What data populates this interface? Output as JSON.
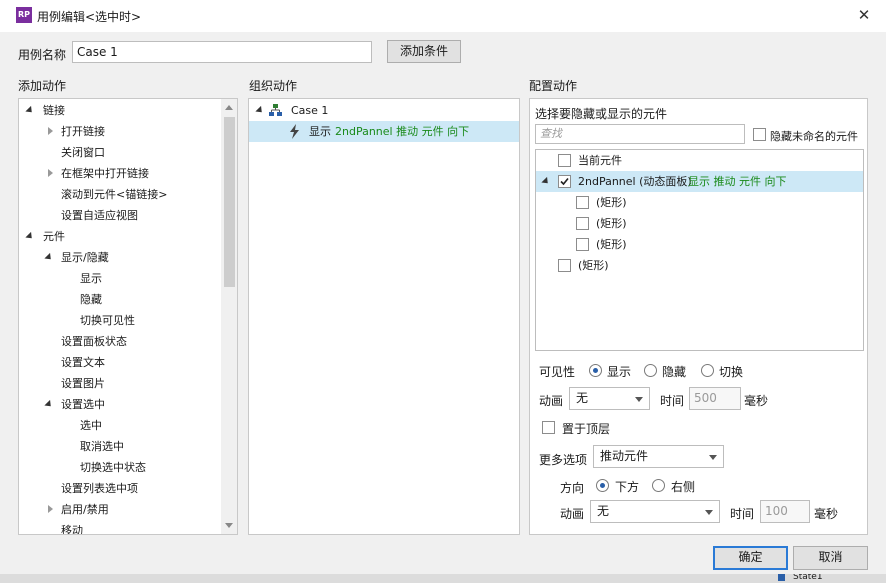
{
  "window": {
    "title": "用例编辑<选中时>",
    "app_icon": "RP"
  },
  "case_name": {
    "label": "用例名称",
    "value": "Case 1",
    "add_condition": "添加条件"
  },
  "add_actions": {
    "heading": "添加动作",
    "items": [
      {
        "label": "链接"
      },
      {
        "label": "打开链接"
      },
      {
        "label": "关闭窗口"
      },
      {
        "label": "在框架中打开链接"
      },
      {
        "label": "滚动到元件<锚链接>"
      },
      {
        "label": "设置自适应视图"
      },
      {
        "label": "元件"
      },
      {
        "label": "显示/隐藏"
      },
      {
        "label": "显示"
      },
      {
        "label": "隐藏"
      },
      {
        "label": "切换可见性"
      },
      {
        "label": "设置面板状态"
      },
      {
        "label": "设置文本"
      },
      {
        "label": "设置图片"
      },
      {
        "label": "设置选中"
      },
      {
        "label": "选中"
      },
      {
        "label": "取消选中"
      },
      {
        "label": "切换选中状态"
      },
      {
        "label": "设置列表选中项"
      },
      {
        "label": "启用/禁用"
      },
      {
        "label": "移动"
      }
    ]
  },
  "organize_actions": {
    "heading": "组织动作",
    "case": "Case 1",
    "action": {
      "verb": "显示",
      "detail": "2ndPannel 推动 元件 向下"
    }
  },
  "configure": {
    "heading": "配置动作",
    "prompt": "选择要隐藏或显示的元件",
    "search_placeholder": "查找",
    "hide_unnamed": "隐藏未命名的元件",
    "widgets": [
      {
        "label": "当前元件",
        "checked": false
      },
      {
        "label": "2ndPannel (动态面板)",
        "status": "显示 推动 元件 向下",
        "checked": true
      },
      {
        "label": "(矩形)",
        "checked": false
      },
      {
        "label": "(矩形)",
        "checked": false
      },
      {
        "label": "(矩形)",
        "checked": false
      },
      {
        "label": "(矩形)",
        "checked": false
      }
    ],
    "visibility": {
      "label": "可见性",
      "options": [
        "显示",
        "隐藏",
        "切换"
      ],
      "selected": "显示"
    },
    "animation": {
      "label": "动画",
      "value": "无",
      "time_label": "时间",
      "time_value": "500",
      "unit": "毫秒"
    },
    "bring_to_front": "置于顶层",
    "more_options": {
      "label": "更多选项",
      "value": "推动元件"
    },
    "direction": {
      "label": "方向",
      "options": [
        "下方",
        "右侧"
      ],
      "selected": "下方"
    },
    "push_animation": {
      "label": "动画",
      "value": "无",
      "time_label": "时间",
      "time_value": "100",
      "unit": "毫秒"
    }
  },
  "footer": {
    "ok": "确定",
    "cancel": "取消"
  },
  "background_fragment": {
    "label": "State1"
  },
  "colors": {
    "accent": "#2a5fa8",
    "selection": "#cde8f6",
    "green_text": "#1a8a1a",
    "brand": "#7a2e9e"
  }
}
